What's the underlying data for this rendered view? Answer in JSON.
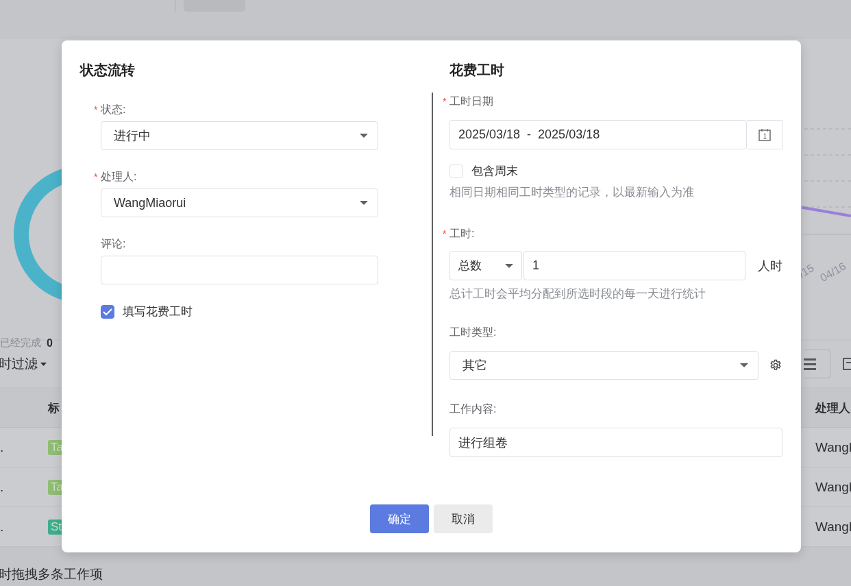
{
  "background": {
    "summary": {
      "label": "已经完成",
      "count": "0"
    },
    "chart_labels": [
      "/15",
      "04/16"
    ],
    "filter": {
      "label": "时过滤"
    },
    "table": {
      "columns": [
        "标",
        "处理人"
      ],
      "rows": [
        {
          "column_1": ".",
          "tag": {
            "text": "Ta",
            "color": "#8fbd73"
          },
          "assignee": "Wangl"
        },
        {
          "column_1": ".",
          "tag": {
            "text": "Ta",
            "color": "#8fbd73"
          },
          "assignee": "Wangl"
        },
        {
          "column_1": ".",
          "tag": {
            "text": "St",
            "color": "#3fae8e"
          },
          "assignee": "Wangl"
        }
      ]
    },
    "footer_text": "时拖拽多条工作项"
  },
  "dialog": {
    "left": {
      "title": "状态流转",
      "fields": [
        {
          "kind": "select",
          "required_mark": "*",
          "label": "状态:",
          "value": "进行中"
        },
        {
          "kind": "select",
          "required_mark": "*",
          "label": "处理人:",
          "value": "WangMiaorui"
        },
        {
          "kind": "input",
          "label": "评论:"
        }
      ],
      "log_hours": {
        "label": "填写花费工时",
        "checked": true
      }
    },
    "right": {
      "title": "花费工时",
      "date_range": {
        "required_mark": "*",
        "label": "工时日期",
        "value": "2025/03/18  -  2025/03/18"
      },
      "weekend": {
        "label": "包含周末",
        "checked": false
      },
      "date_hint": "相同日期相同工时类型的记录，以最新输入为准",
      "hours": {
        "required_mark": "*",
        "label": "工时:",
        "mode": "总数",
        "value": "1",
        "unit": "人时",
        "hint": "总计工时会平均分配到所选时段的每一天进行统计"
      },
      "hour_type": {
        "label": "工时类型:",
        "value": "其它"
      },
      "content": {
        "label": "工作内容:",
        "value": "进行组卷"
      }
    },
    "buttons": [
      {
        "label": "确定",
        "kind": "primary"
      },
      {
        "label": "取消",
        "kind": "secondary"
      }
    ]
  }
}
